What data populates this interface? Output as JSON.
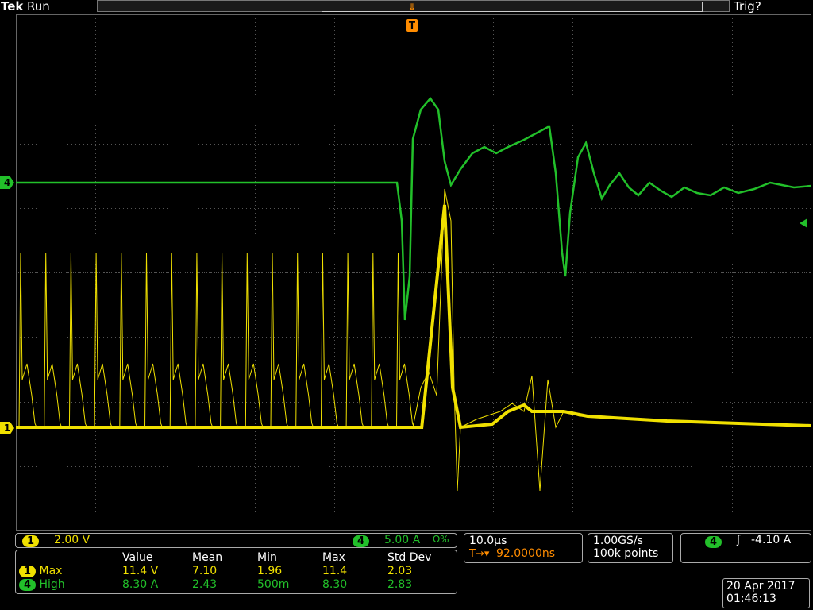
{
  "header": {
    "brand": "Tek",
    "run_state": "Run",
    "trigger_state": "Trig?"
  },
  "markers": {
    "ch4": "4",
    "ch1": "1",
    "trigger": "T"
  },
  "ch1_scale": {
    "channel": "1",
    "value": "2.00 V"
  },
  "ch4_scale": {
    "channel": "4",
    "value": "5.00 A",
    "coupling": "Ω%"
  },
  "timebase": {
    "scale": "10.0µs",
    "trigger_prefix": "T→▾",
    "position": "92.0000ns"
  },
  "acquisition": {
    "rate": "1.00GS/s",
    "points": "100k points"
  },
  "trigger": {
    "channel": "4",
    "slope": "ʃ",
    "level": "-4.10 A"
  },
  "measurements": {
    "columns": [
      "Value",
      "Mean",
      "Min",
      "Max",
      "Std Dev"
    ],
    "rows": [
      {
        "channel": "1",
        "name": "Max",
        "values": [
          "11.4 V",
          "7.10",
          "1.96",
          "11.4",
          "2.03"
        ]
      },
      {
        "channel": "4",
        "name": "High",
        "values": [
          "8.30 A",
          "2.43",
          "500m",
          "8.30",
          "2.83"
        ]
      }
    ]
  },
  "datetime": {
    "date": "20 Apr 2017",
    "time": "01:46:13"
  },
  "colors": {
    "ch1": "#f0e000",
    "ch4": "#22c02a",
    "trigger": "#ff8c00"
  }
}
